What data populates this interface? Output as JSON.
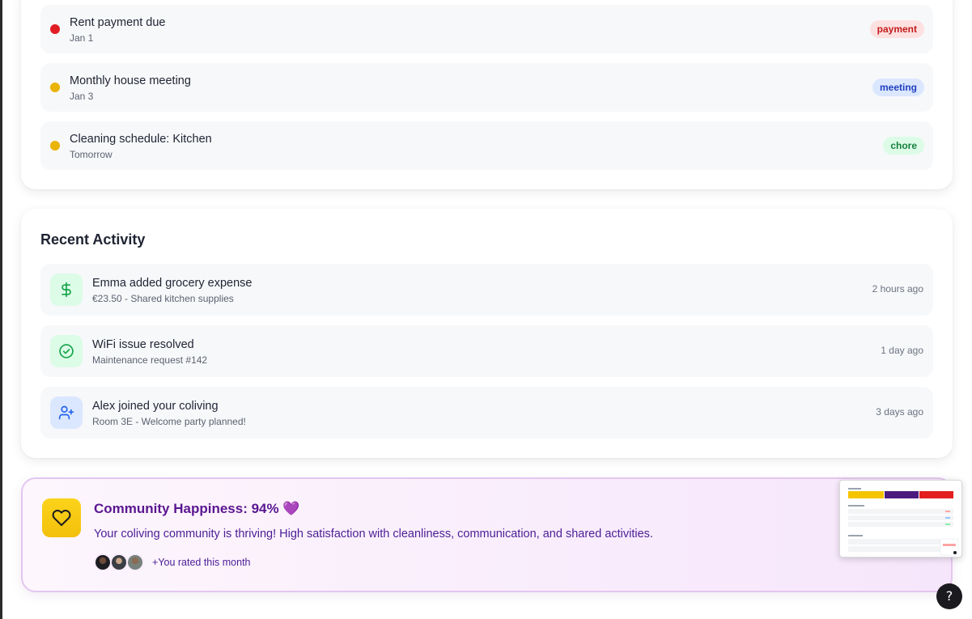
{
  "events": [
    {
      "title": "Rent payment due",
      "date": "Jan 1",
      "tag": "payment",
      "dot_color": "#e11d24",
      "tag_bg": "#fde1e1",
      "tag_color": "#c21b1b"
    },
    {
      "title": "Monthly house meeting",
      "date": "Jan 3",
      "tag": "meeting",
      "dot_color": "#eab308",
      "tag_bg": "#dbe7fe",
      "tag_color": "#1f3fbf"
    },
    {
      "title": "Cleaning schedule: Kitchen",
      "date": "Tomorrow",
      "tag": "chore",
      "dot_color": "#eab308",
      "tag_bg": "#dcfce7",
      "tag_color": "#15803d"
    }
  ],
  "recent_activity": {
    "title": "Recent Activity",
    "items": [
      {
        "icon": "dollar-icon",
        "title": "Emma added grocery expense",
        "subtitle": "€23.50 - Shared kitchen supplies",
        "time": "2 hours ago",
        "icon_bg": "#dcfce7",
        "icon_color": "#16a34a"
      },
      {
        "icon": "check-circle-icon",
        "title": "WiFi issue resolved",
        "subtitle": "Maintenance request #142",
        "time": "1 day ago",
        "icon_bg": "#dcfce7",
        "icon_color": "#16a34a"
      },
      {
        "icon": "user-plus-icon",
        "title": "Alex joined your coliving",
        "subtitle": "Room 3E - Welcome party planned!",
        "time": "3 days ago",
        "icon_bg": "#dbe7fe",
        "icon_color": "#2563eb"
      }
    ]
  },
  "happiness": {
    "title": "Community Happiness: 94% 💜",
    "description": "Your coliving community is thriving! High satisfaction with cleanliness, communication, and shared activities.",
    "rated_text": "+You rated this month",
    "icon": "heart-icon"
  },
  "help_label": "?"
}
